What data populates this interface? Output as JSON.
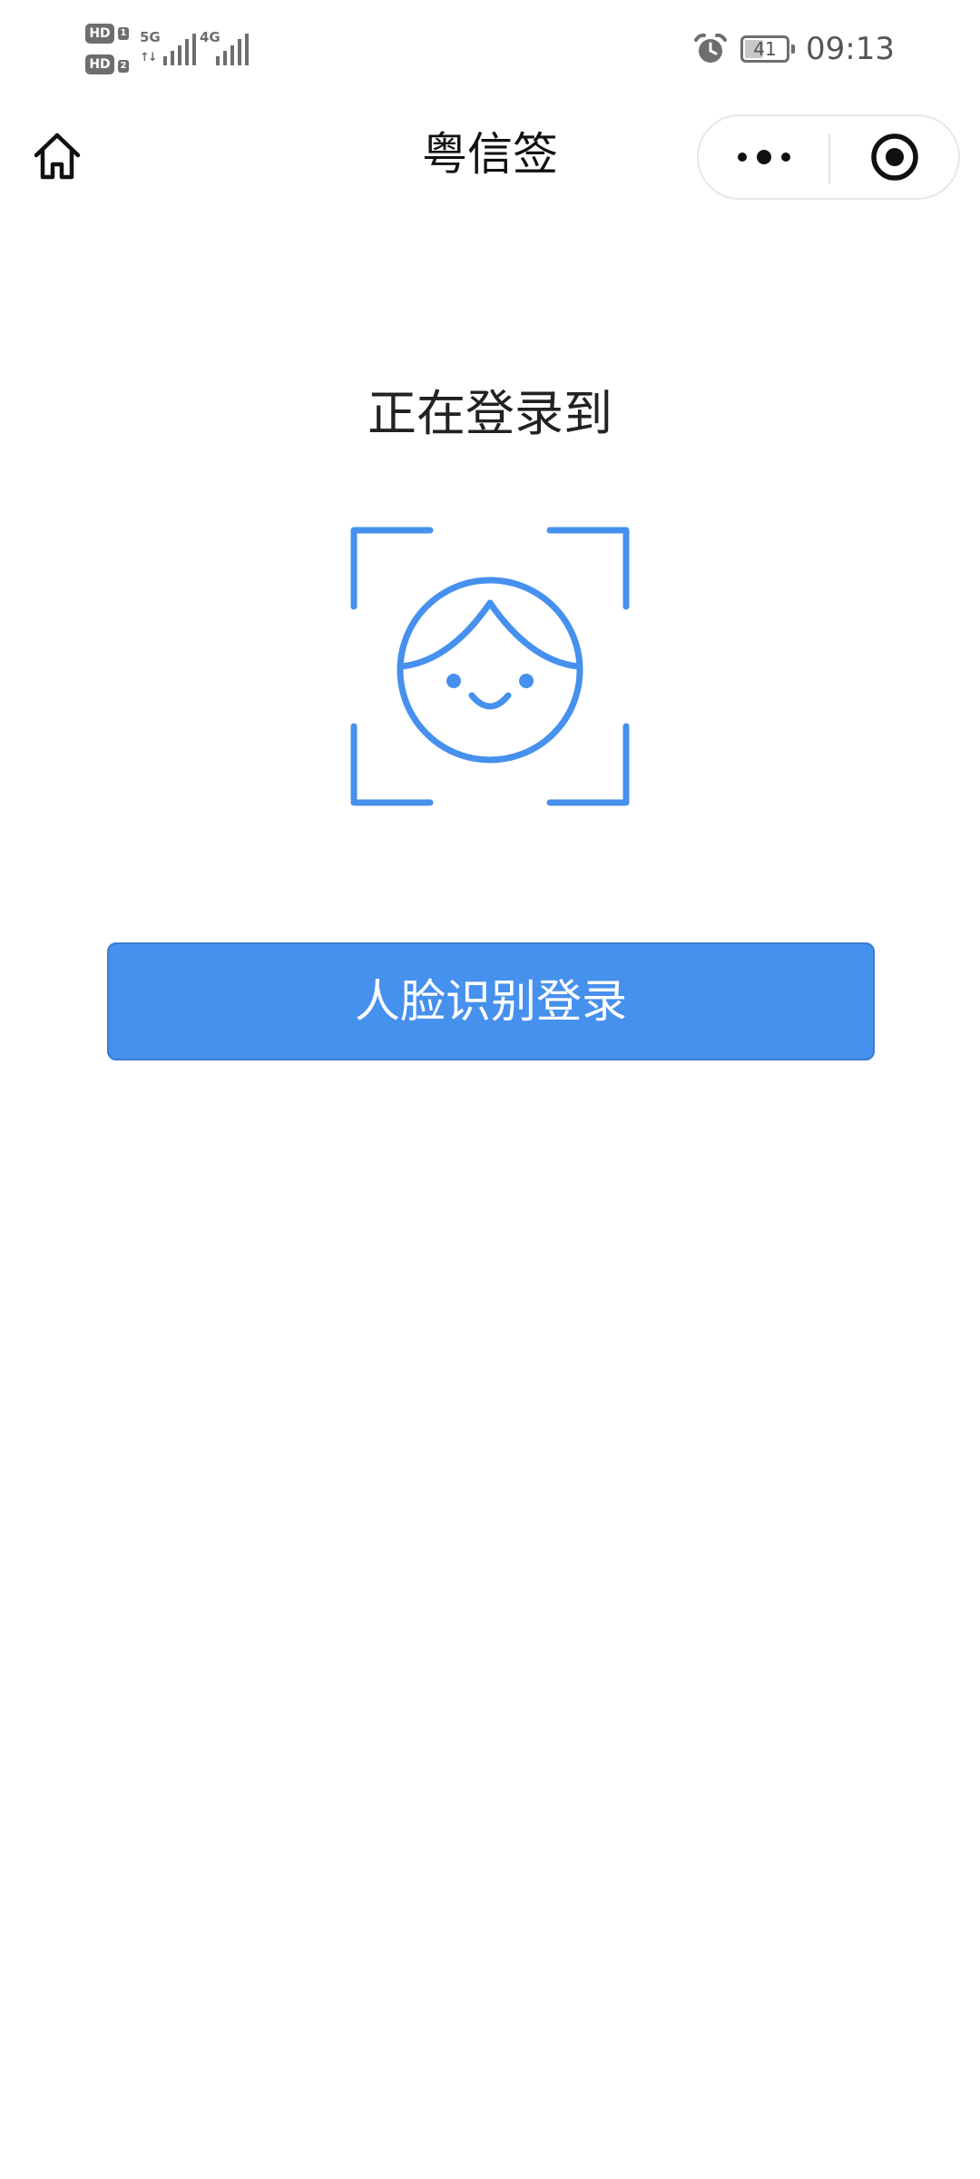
{
  "status_bar": {
    "sim1_badge": "HD",
    "sim1_number": "1",
    "sim2_badge": "HD",
    "sim2_number": "2",
    "network1": "5G",
    "network2": "4G",
    "battery_level": "41",
    "time": "09:13",
    "icons": [
      "alarm-icon",
      "signal-icon",
      "battery-icon"
    ]
  },
  "nav": {
    "title": "粤信签",
    "home_icon": "home-icon",
    "more_icon": "more-dots-icon",
    "close_icon": "target-close-icon"
  },
  "main": {
    "heading": "正在登录到",
    "face_icon": "face-recognition-icon",
    "login_button_label": "人脸识别登录"
  },
  "colors": {
    "accent": "#4690ee",
    "accent_border": "#3a7bd4",
    "face_icon": "#4690ee",
    "status_gray": "#6e6e6e"
  }
}
